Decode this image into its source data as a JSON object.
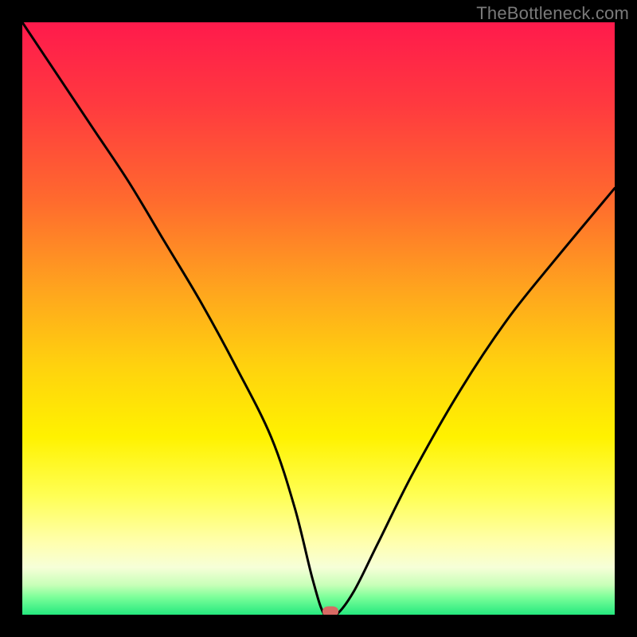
{
  "watermark": "TheBottleneck.com",
  "chart_data": {
    "type": "line",
    "title": "",
    "xlabel": "",
    "ylabel": "",
    "xlim": [
      0,
      100
    ],
    "ylim": [
      0,
      100
    ],
    "grid": false,
    "legend": false,
    "series": [
      {
        "name": "curve",
        "x": [
          0,
          6,
          12,
          18,
          24,
          30,
          36,
          42,
          46,
          49,
          51,
          53,
          56,
          60,
          66,
          74,
          82,
          90,
          100
        ],
        "y": [
          100,
          91,
          82,
          73,
          63,
          53,
          42,
          30,
          18,
          6,
          0,
          0,
          4,
          12,
          24,
          38,
          50,
          60,
          72
        ]
      }
    ],
    "marker": {
      "x": 52,
      "y": 0
    },
    "background_gradient": {
      "top": "#ff1a4c",
      "mid": "#fff200",
      "bottom": "#25e87e"
    }
  }
}
